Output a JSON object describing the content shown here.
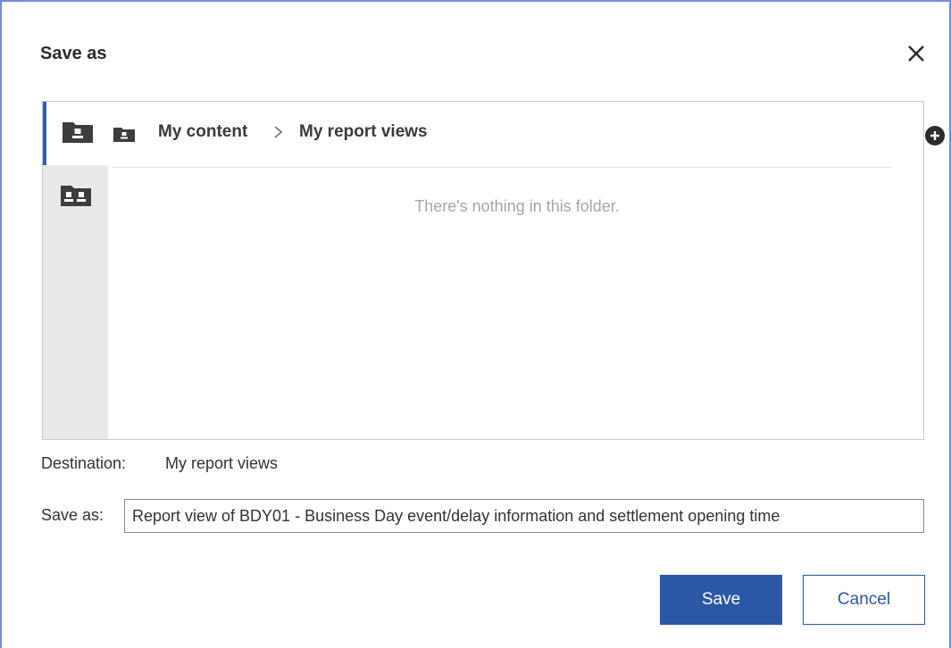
{
  "dialog": {
    "title": "Save as",
    "close_icon": "close-icon"
  },
  "rail": {
    "items": [
      {
        "icon": "my-content-folder-icon",
        "selected": true
      },
      {
        "icon": "team-content-folder-icon",
        "selected": false
      }
    ]
  },
  "breadcrumb": {
    "folder_icon": "my-content-folder-icon",
    "items": [
      "My content",
      "My report views"
    ],
    "separator": ">",
    "add_icon": "add-circle-icon"
  },
  "folder": {
    "empty_message": "There's nothing in this folder."
  },
  "destination": {
    "label": "Destination:",
    "value": "My report views"
  },
  "save_as": {
    "label": "Save as:",
    "value": "Report view of BDY01 - Business Day event/delay information and settlement opening time"
  },
  "buttons": {
    "save": "Save",
    "cancel": "Cancel"
  },
  "colors": {
    "primary": "#2958a6",
    "selection_bar": "#2f5fb0",
    "rail_bg": "#e9e9e9",
    "frame": "#6f8fd8"
  }
}
